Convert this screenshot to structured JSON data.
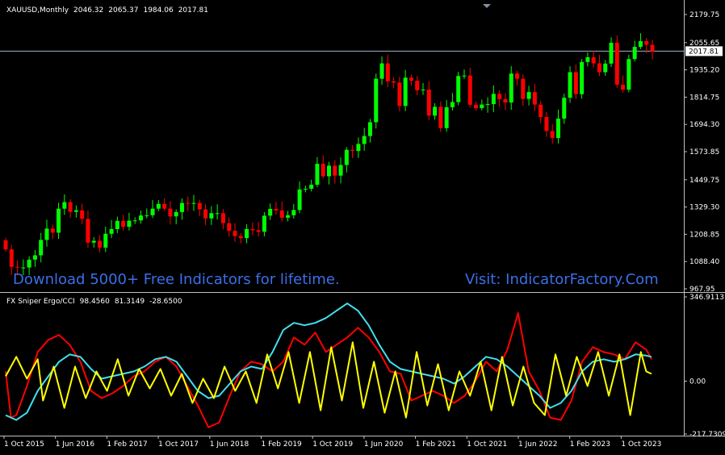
{
  "header": {
    "symbol": "XAUUSD,Monthly",
    "open": "2046.32",
    "high": "2065.37",
    "low": "1984.06",
    "close": "2017.81"
  },
  "indicator_header": {
    "name": "FX Sniper Ergo/CCI",
    "v1": "98.4560",
    "v2": "81.3149",
    "v3": "-28.6500"
  },
  "banner": {
    "left": "Download 5000+ Free Indicators for lifetime.",
    "right": "Visit: IndicatorFactory.Com"
  },
  "colors": {
    "background": "#000000",
    "up_candle": "#00ff00",
    "down_candle": "#ff0000",
    "axis": "#c0c0c0",
    "price_line": "#a0b4c8",
    "ergo_red": "#ff0000",
    "ergo_cyan": "#40e0f0",
    "cci_yellow": "#ffff00",
    "banner": "#3b6fe8"
  },
  "chart_data": [
    {
      "type": "candlestick",
      "title": "XAUUSD,Monthly",
      "ylim": [
        967.95,
        2179.75
      ],
      "y_ticks": [
        "2179.75",
        "2055.65",
        "1935.20",
        "1814.75",
        "1694.30",
        "1573.85",
        "1449.75",
        "1329.30",
        "1208.85",
        "1088.40",
        "967.95"
      ],
      "current_price_label": "2017.81",
      "current_price": 2017.81,
      "series": [
        {
          "name": "XAUUSD",
          "close": [
            1142,
            1065,
            1062,
            1062,
            1097,
            1116,
            1184,
            1234,
            1216,
            1322,
            1351,
            1308,
            1315,
            1277,
            1172,
            1180,
            1150,
            1211,
            1232,
            1268,
            1242,
            1269,
            1270,
            1292,
            1293,
            1322,
            1343,
            1322,
            1288,
            1307,
            1347,
            1344,
            1347,
            1319,
            1279,
            1302,
            1302,
            1258,
            1224,
            1201,
            1192,
            1232,
            1227,
            1220,
            1291,
            1321,
            1314,
            1282,
            1293,
            1316,
            1407,
            1410,
            1428,
            1520,
            1465,
            1512,
            1468,
            1515,
            1582,
            1577,
            1608,
            1643,
            1704,
            1896,
            1964,
            1885,
            1879,
            1776,
            1901,
            1887,
            1845,
            1848,
            1733,
            1772,
            1678,
            1770,
            1793,
            1908,
            1910,
            1781,
            1766,
            1782,
            1784,
            1829,
            1806,
            1791,
            1919,
            1896,
            1807,
            1837,
            1782,
            1727,
            1665,
            1634,
            1720,
            1812,
            1925,
            1828,
            1970,
            1991,
            1964,
            1925,
            1963,
            2055,
            1870,
            1848,
            1983,
            2037,
            2062,
            2046,
            2017
          ]
        }
      ]
    },
    {
      "type": "line",
      "title": "FX Sniper Ergo/CCI",
      "ylim": [
        -217.7309,
        346.9113
      ],
      "y_ticks": [
        "346.9113",
        "0.00",
        "-217.7309"
      ],
      "x_tick_labels": [
        "1 Oct 2015",
        "1 Jun 2016",
        "1 Feb 2017",
        "1 Oct 2017",
        "1 Jun 2018",
        "1 Feb 2019",
        "1 Oct 2019",
        "1 Jun 2020",
        "1 Feb 2021",
        "1 Oct 2021",
        "1 Jun 2022",
        "1 Feb 2023",
        "1 Oct 2023"
      ],
      "series": [
        {
          "name": "Ergo signal red",
          "color": "#ff0000",
          "points": [
            [
              0,
              40
            ],
            [
              1,
              -150
            ],
            [
              2,
              -140
            ],
            [
              4,
              -20
            ],
            [
              6,
              120
            ],
            [
              8,
              170
            ],
            [
              10,
              190
            ],
            [
              12,
              150
            ],
            [
              14,
              80
            ],
            [
              16,
              -40
            ],
            [
              18,
              -70
            ],
            [
              20,
              -50
            ],
            [
              22,
              -20
            ],
            [
              24,
              20
            ],
            [
              26,
              40
            ],
            [
              28,
              80
            ],
            [
              30,
              100
            ],
            [
              32,
              60
            ],
            [
              34,
              -20
            ],
            [
              36,
              -100
            ],
            [
              38,
              -190
            ],
            [
              40,
              -170
            ],
            [
              42,
              -60
            ],
            [
              44,
              40
            ],
            [
              46,
              80
            ],
            [
              48,
              70
            ],
            [
              50,
              40
            ],
            [
              52,
              80
            ],
            [
              54,
              180
            ],
            [
              56,
              150
            ],
            [
              58,
              200
            ],
            [
              60,
              120
            ],
            [
              62,
              150
            ],
            [
              64,
              180
            ],
            [
              66,
              220
            ],
            [
              68,
              180
            ],
            [
              70,
              120
            ],
            [
              72,
              40
            ],
            [
              74,
              30
            ],
            [
              76,
              -80
            ],
            [
              78,
              -60
            ],
            [
              80,
              -40
            ],
            [
              82,
              -60
            ],
            [
              84,
              -90
            ],
            [
              86,
              -60
            ],
            [
              88,
              0
            ],
            [
              90,
              80
            ],
            [
              92,
              40
            ],
            [
              94,
              130
            ],
            [
              96,
              280
            ],
            [
              98,
              40
            ],
            [
              100,
              -40
            ],
            [
              102,
              -150
            ],
            [
              104,
              -160
            ],
            [
              106,
              -80
            ],
            [
              108,
              80
            ],
            [
              110,
              140
            ],
            [
              112,
              120
            ],
            [
              114,
              110
            ],
            [
              116,
              90
            ],
            [
              118,
              160
            ],
            [
              120,
              130
            ],
            [
              121,
              90
            ]
          ]
        },
        {
          "name": "Ergo cyan",
          "color": "#40e0f0",
          "points": [
            [
              0,
              -140
            ],
            [
              2,
              -160
            ],
            [
              4,
              -130
            ],
            [
              6,
              -40
            ],
            [
              8,
              20
            ],
            [
              10,
              80
            ],
            [
              12,
              110
            ],
            [
              14,
              100
            ],
            [
              16,
              50
            ],
            [
              18,
              10
            ],
            [
              20,
              20
            ],
            [
              22,
              30
            ],
            [
              24,
              40
            ],
            [
              26,
              60
            ],
            [
              28,
              90
            ],
            [
              30,
              100
            ],
            [
              32,
              80
            ],
            [
              34,
              20
            ],
            [
              36,
              -40
            ],
            [
              38,
              -70
            ],
            [
              40,
              -60
            ],
            [
              42,
              -10
            ],
            [
              44,
              40
            ],
            [
              46,
              60
            ],
            [
              48,
              50
            ],
            [
              50,
              120
            ],
            [
              52,
              210
            ],
            [
              54,
              240
            ],
            [
              56,
              230
            ],
            [
              58,
              240
            ],
            [
              60,
              260
            ],
            [
              62,
              290
            ],
            [
              64,
              320
            ],
            [
              66,
              290
            ],
            [
              68,
              230
            ],
            [
              70,
              150
            ],
            [
              72,
              80
            ],
            [
              74,
              50
            ],
            [
              76,
              40
            ],
            [
              78,
              30
            ],
            [
              80,
              20
            ],
            [
              82,
              10
            ],
            [
              84,
              -10
            ],
            [
              86,
              20
            ],
            [
              88,
              60
            ],
            [
              90,
              100
            ],
            [
              92,
              90
            ],
            [
              94,
              60
            ],
            [
              96,
              20
            ],
            [
              98,
              -20
            ],
            [
              100,
              -60
            ],
            [
              102,
              -110
            ],
            [
              104,
              -90
            ],
            [
              106,
              -40
            ],
            [
              108,
              40
            ],
            [
              110,
              80
            ],
            [
              112,
              90
            ],
            [
              114,
              80
            ],
            [
              116,
              90
            ],
            [
              118,
              110
            ],
            [
              120,
              105
            ],
            [
              121,
              100
            ]
          ]
        },
        {
          "name": "CCI yellow",
          "color": "#ffff00",
          "points": [
            [
              0,
              20
            ],
            [
              2,
              100
            ],
            [
              4,
              10
            ],
            [
              6,
              90
            ],
            [
              7,
              -80
            ],
            [
              9,
              60
            ],
            [
              11,
              -110
            ],
            [
              13,
              60
            ],
            [
              15,
              -70
            ],
            [
              17,
              40
            ],
            [
              19,
              -40
            ],
            [
              21,
              90
            ],
            [
              23,
              -60
            ],
            [
              25,
              50
            ],
            [
              27,
              -30
            ],
            [
              29,
              50
            ],
            [
              31,
              -60
            ],
            [
              33,
              30
            ],
            [
              35,
              -90
            ],
            [
              37,
              10
            ],
            [
              39,
              -70
            ],
            [
              41,
              60
            ],
            [
              43,
              -40
            ],
            [
              45,
              40
            ],
            [
              47,
              -90
            ],
            [
              49,
              110
            ],
            [
              51,
              -30
            ],
            [
              53,
              120
            ],
            [
              55,
              -90
            ],
            [
              57,
              120
            ],
            [
              59,
              -120
            ],
            [
              61,
              140
            ],
            [
              63,
              -80
            ],
            [
              65,
              160
            ],
            [
              67,
              -110
            ],
            [
              69,
              80
            ],
            [
              71,
              -130
            ],
            [
              73,
              40
            ],
            [
              75,
              -150
            ],
            [
              77,
              120
            ],
            [
              79,
              -100
            ],
            [
              81,
              70
            ],
            [
              83,
              -120
            ],
            [
              85,
              40
            ],
            [
              87,
              -60
            ],
            [
              89,
              80
            ],
            [
              91,
              -120
            ],
            [
              93,
              100
            ],
            [
              95,
              -100
            ],
            [
              97,
              60
            ],
            [
              99,
              -90
            ],
            [
              101,
              -140
            ],
            [
              103,
              110
            ],
            [
              105,
              -60
            ],
            [
              107,
              100
            ],
            [
              109,
              -20
            ],
            [
              111,
              120
            ],
            [
              113,
              -60
            ],
            [
              115,
              110
            ],
            [
              117,
              -140
            ],
            [
              119,
              120
            ],
            [
              120,
              40
            ],
            [
              121,
              30
            ]
          ]
        }
      ]
    }
  ]
}
